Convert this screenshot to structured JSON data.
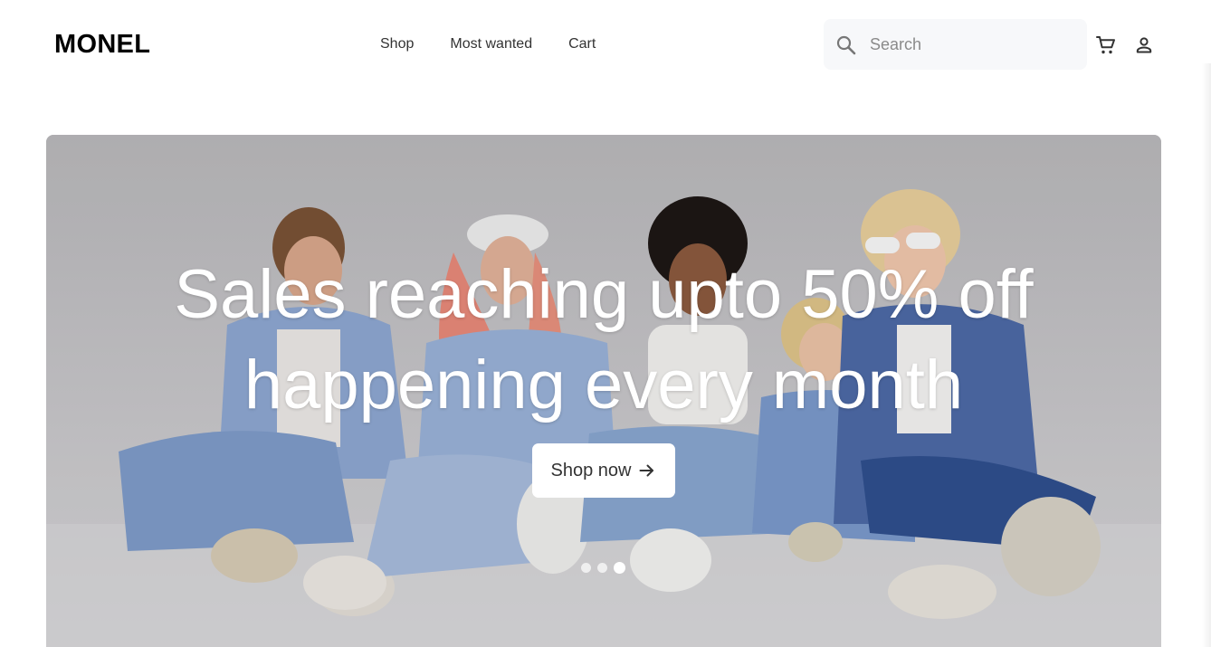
{
  "header": {
    "logo": "MONEL",
    "nav": [
      {
        "label": "Shop"
      },
      {
        "label": "Most wanted"
      },
      {
        "label": "Cart"
      }
    ],
    "search": {
      "placeholder": "Search",
      "value": "",
      "icon": "search-icon"
    },
    "icons": {
      "cart": "cart-icon",
      "account": "user-icon"
    }
  },
  "hero": {
    "title": "Sales reaching upto 50% off happening every month",
    "cta_label": "Shop now",
    "cta_icon": "arrow-right-icon",
    "carousel": {
      "slides": 3,
      "active_index": 2
    }
  },
  "colors": {
    "background": "#ffffff",
    "text": "#333333",
    "search_bg": "#f7f8fa",
    "hero_text": "#ffffff",
    "button_bg": "#ffffff"
  }
}
